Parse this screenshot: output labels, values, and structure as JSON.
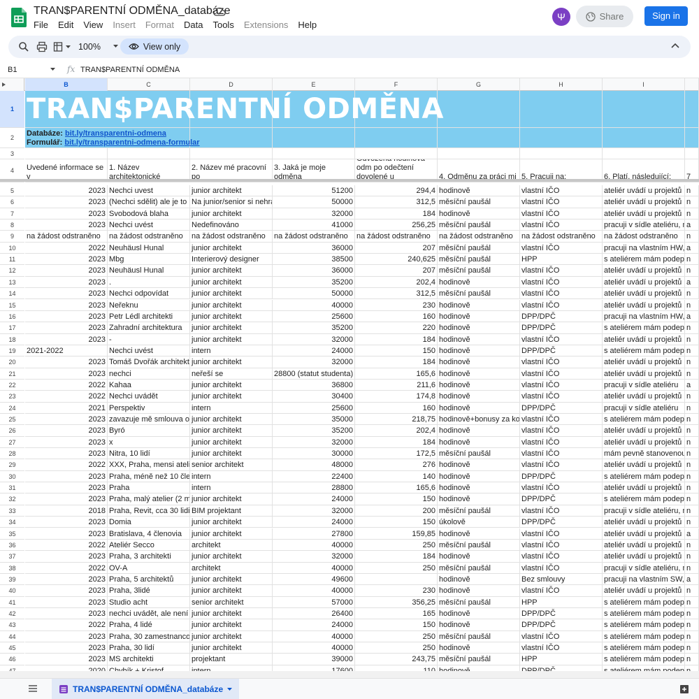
{
  "app": {
    "doc_title": "TRAN$PARENTNÍ ODMĚNA_databáze",
    "menu": [
      {
        "label": "File",
        "disabled": false
      },
      {
        "label": "Edit",
        "disabled": false
      },
      {
        "label": "View",
        "disabled": false
      },
      {
        "label": "Insert",
        "disabled": true
      },
      {
        "label": "Format",
        "disabled": true
      },
      {
        "label": "Data",
        "disabled": false
      },
      {
        "label": "Tools",
        "disabled": false
      },
      {
        "label": "Extensions",
        "disabled": true
      },
      {
        "label": "Help",
        "disabled": false
      }
    ],
    "share_label": "Share",
    "signin_label": "Sign in"
  },
  "toolbar": {
    "zoom": "100%",
    "view_only_label": "View only"
  },
  "formula_bar": {
    "cell_ref": "B1",
    "formula": "TRAN$PARENTNÍ ODMĚNA"
  },
  "columns": [
    "B",
    "C",
    "D",
    "E",
    "F",
    "G",
    "H",
    "I"
  ],
  "sheet": {
    "title": "TRAN$PARENTNÍ ODMĚNA",
    "db_label": "Databáze:",
    "db_link": "bit.ly/transparentni-odmena",
    "form_label": "Formulář:",
    "form_link": "bit.ly/transparentni-odmena-formular",
    "headers": [
      "Uvedené informace se v",
      "1. Název architektonické",
      "2. Název mé pracovní po",
      "3. Jaká je moje odměna",
      "Odvozená hodinová odm po odečtení dovolené u",
      "4.  Odměnu za práci mi",
      "5. Pracuji na:",
      "6. Platí, následující:",
      "7"
    ],
    "rows": [
      [
        "2023",
        "Nechci uvest",
        "junior architekt",
        "51200",
        "294,4",
        "hodinově",
        "vlastní IČO",
        "ateliér uvádí u projektů m",
        "n"
      ],
      [
        "2023",
        "(Nechci sdělit) ale je to",
        "Na junior/senior si nehra",
        "50000",
        "312,5",
        "měsíční paušál",
        "vlastní IČO",
        "ateliér uvádí u projektů m",
        "n"
      ],
      [
        "2023",
        "Svobodová blaha",
        "junior architekt",
        "32000",
        "184",
        "hodinově",
        "vlastní IČO",
        "ateliér uvádí u projektů m",
        "n"
      ],
      [
        "2023",
        "Nechci uvést",
        "Nedefinováno",
        "41000",
        "256,25",
        "měsíční paušál",
        "vlastní IČO",
        "pracuji v sídle ateliéru, m",
        "a"
      ],
      [
        "na žádost odstraněno",
        "na žádost odstraněno",
        "na žádost odstraněno",
        "na žádost odstraněno",
        "na žádost odstraněno",
        "na žádost odstraněno",
        "na žádost odstraněno",
        "na žádost odstraněno",
        "n"
      ],
      [
        "2022",
        "Neuhäusl Hunal",
        "junior architekt",
        "36000",
        "207",
        "měsíční paušál",
        "vlastní IČO",
        "pracuji na vlastním HW,",
        "a"
      ],
      [
        "2023",
        "Mbg",
        "Interierový designer",
        "38500",
        "240,625",
        "měsíční paušál",
        "HPP",
        "s ateliérem mám podeps",
        "n"
      ],
      [
        "2023",
        "Neuhäusl Hunal",
        "junior architekt",
        "36000",
        "207",
        "měsíční paušál",
        "vlastní IČO",
        "ateliér uvádí u projektů m",
        "n"
      ],
      [
        "2023",
        ".",
        "junior architekt",
        "35200",
        "202,4",
        "hodinově",
        "vlastní IČO",
        "ateliér uvádí u projektů m",
        "a"
      ],
      [
        "2023",
        "Nechci odpovídat",
        "junior architekt",
        "50000",
        "312,5",
        "měsíční paušál",
        "vlastní IČO",
        "ateliér uvádí u projektů m",
        "n"
      ],
      [
        "2023",
        "Neřeknu",
        "junior architekt",
        "40000",
        "230",
        "hodinově",
        "vlastní IČO",
        "ateliér uvádí u projektů m",
        "n"
      ],
      [
        "2023",
        "Petr Lédl architekti",
        "junior architekt",
        "25600",
        "160",
        "hodinově",
        "DPP/DPČ",
        "pracuji na vlastním HW,",
        "a"
      ],
      [
        "2023",
        "Zahradní architektura",
        "junior architekt",
        "35200",
        "220",
        "hodinově",
        "DPP/DPČ",
        "s ateliérem mám podeps",
        "n"
      ],
      [
        "2023",
        "-",
        "junior architekt",
        "32000",
        "184",
        "hodinově",
        "vlastní IČO",
        "ateliér uvádí u projektů m",
        "n"
      ],
      [
        "2021-2022",
        "Nechci uvést",
        "intern",
        "24000",
        "150",
        "hodinově",
        "DPP/DPČ",
        "s ateliérem mám podeps",
        "n"
      ],
      [
        "2023",
        "Tomáš Dvořák architekt",
        "junior architekt",
        "32000",
        "184",
        "hodinově",
        "vlastní IČO",
        "ateliér uvádí u projektů m",
        "n"
      ],
      [
        "2023",
        "nechci",
        "neřeší se",
        "28800 (statut studenta)",
        "165,6",
        "hodinově",
        "vlastní IČO",
        "ateliér uvádí u projektů m",
        "n"
      ],
      [
        "2022",
        "Kahaa",
        "junior architekt",
        "36800",
        "211,6",
        "hodinově",
        "vlastní IČO",
        "pracuji v sídle ateliéru",
        "a"
      ],
      [
        "2022",
        "Nechci uvádět",
        "junior architekt",
        "30400",
        "174,8",
        "hodinově",
        "vlastní IČO",
        "ateliér uvádí u projektů m",
        "n"
      ],
      [
        "2021",
        "Perspektiv",
        "intern",
        "25600",
        "160",
        "hodinově",
        "DPP/DPČ",
        "pracuji v sídle ateliéru",
        "n"
      ],
      [
        "2023",
        "zavazuje mě smlouva o",
        "junior architekt",
        "35000",
        "218,75",
        "hodinově+bonusy za ko",
        "vlastní IČO",
        "s ateliérem mám podeps",
        "n"
      ],
      [
        "2023",
        "Byró",
        "junior architekt",
        "35200",
        "202,4",
        "hodinově",
        "vlastní IČO",
        "ateliér uvádí u projektů m",
        "n"
      ],
      [
        "2023",
        "x",
        "junior architekt",
        "32000",
        "184",
        "hodinově",
        "vlastní IČO",
        "ateliér uvádí u projektů m",
        "n"
      ],
      [
        "2023",
        "Nitra, 10 lidí",
        "junior architekt",
        "30000",
        "172,5",
        "měsíční paušál",
        "vlastní IČO",
        "mám pevně stanovenou",
        "n"
      ],
      [
        "2022",
        "XXX, Praha, mensi ateli",
        "senior architekt",
        "48000",
        "276",
        "hodinově",
        "vlastní IČO",
        "ateliér uvádí u projektů m",
        "n"
      ],
      [
        "2023",
        "Praha, méně než 10 člen",
        "intern",
        "22400",
        "140",
        "hodinově",
        "DPP/DPČ",
        "s ateliérem mám podeps",
        "n"
      ],
      [
        "2023",
        "Praha",
        "intern",
        "28800",
        "165,6",
        "hodinově",
        "vlastní IČO",
        "ateliér uvádí u projektů m",
        "n"
      ],
      [
        "2023",
        "Praha, malý atelier (2 m",
        "junior architekt",
        "24000",
        "150",
        "hodinově",
        "DPP/DPČ",
        "s ateliérem mám podeps",
        "n"
      ],
      [
        "2018",
        "Praha, Revit, cca 30 lidi",
        "BIM projektant",
        "32000",
        "200",
        "měsíční paušál",
        "vlastní IČO",
        "pracuji v sídle ateliéru, m",
        "n"
      ],
      [
        "2023",
        "Domia",
        "junior architekt",
        "24000",
        "150",
        "úkolově",
        "DPP/DPČ",
        "ateliér uvádí u projektů m",
        "n"
      ],
      [
        "2023",
        "Bratislava, 4 členovia",
        "junior architekt",
        "27800",
        "159,85",
        "hodinově",
        "vlastní IČO",
        "ateliér uvádí u projektů m",
        "a"
      ],
      [
        "2022",
        "Ateliér Secco",
        "architekt",
        "40000",
        "250",
        "měsíční paušál",
        "vlastní IČO",
        "ateliér uvádí u projektů m",
        "n"
      ],
      [
        "2023",
        "Praha, 3 architekti",
        "junior architekt",
        "32000",
        "184",
        "hodinově",
        "vlastní IČO",
        "ateliér uvádí u projektů m",
        "n"
      ],
      [
        "2022",
        "OV-A",
        "architekt",
        "40000",
        "250",
        "měsíční paušál",
        "vlastní IČO",
        "pracuji v sídle ateliéru, m",
        "n"
      ],
      [
        "2023",
        "Praha, 5 architektů",
        "junior architekt",
        "49600",
        "",
        "hodinově",
        "Bez smlouvy",
        "pracuji na vlastním SW,",
        "a"
      ],
      [
        "2023",
        "Praha, 3lidé",
        "junior architekt",
        "40000",
        "230",
        "hodinově",
        "vlastní IČO",
        "ateliér uvádí u projektů m",
        "n"
      ],
      [
        "2023",
        "Studio acht",
        "senior architekt",
        "57000",
        "356,25",
        "měsíční paušál",
        "HPP",
        "s ateliérem mám podeps",
        "n"
      ],
      [
        "2023",
        "nechci uvádět, ale není",
        "junior architekt",
        "26400",
        "165",
        "hodinově",
        "DPP/DPČ",
        "s ateliérem mám podeps",
        "n"
      ],
      [
        "2022",
        "Praha, 4 lidé",
        "junior architekt",
        "24000",
        "150",
        "hodinově",
        "DPP/DPČ",
        "s ateliérem mám podeps",
        "n"
      ],
      [
        "2023",
        "Praha, 30 zamestnanco",
        "junior architekt",
        "40000",
        "250",
        "měsíční paušál",
        "vlastní IČO",
        "s ateliérem mám podeps",
        "n"
      ],
      [
        "2023",
        "Praha, 30 lidí",
        "junior architekt",
        "40000",
        "250",
        "hodinově",
        "vlastní IČO",
        "s ateliérem mám podeps",
        "n"
      ],
      [
        "2023",
        "MS architekti",
        "projektant",
        "39000",
        "243,75",
        "měsíční paušál",
        "HPP",
        "s ateliérem mám podeps",
        "n"
      ],
      [
        "2020",
        "Chybík + Kristof",
        "intern",
        "17600",
        "110",
        "hodinově",
        "DPP/DPČ",
        "s ateliérem mám podeps",
        "n"
      ]
    ]
  },
  "sheet_tab": {
    "label": "TRAN$PARENTNÍ ODMĚNA_databáze"
  }
}
